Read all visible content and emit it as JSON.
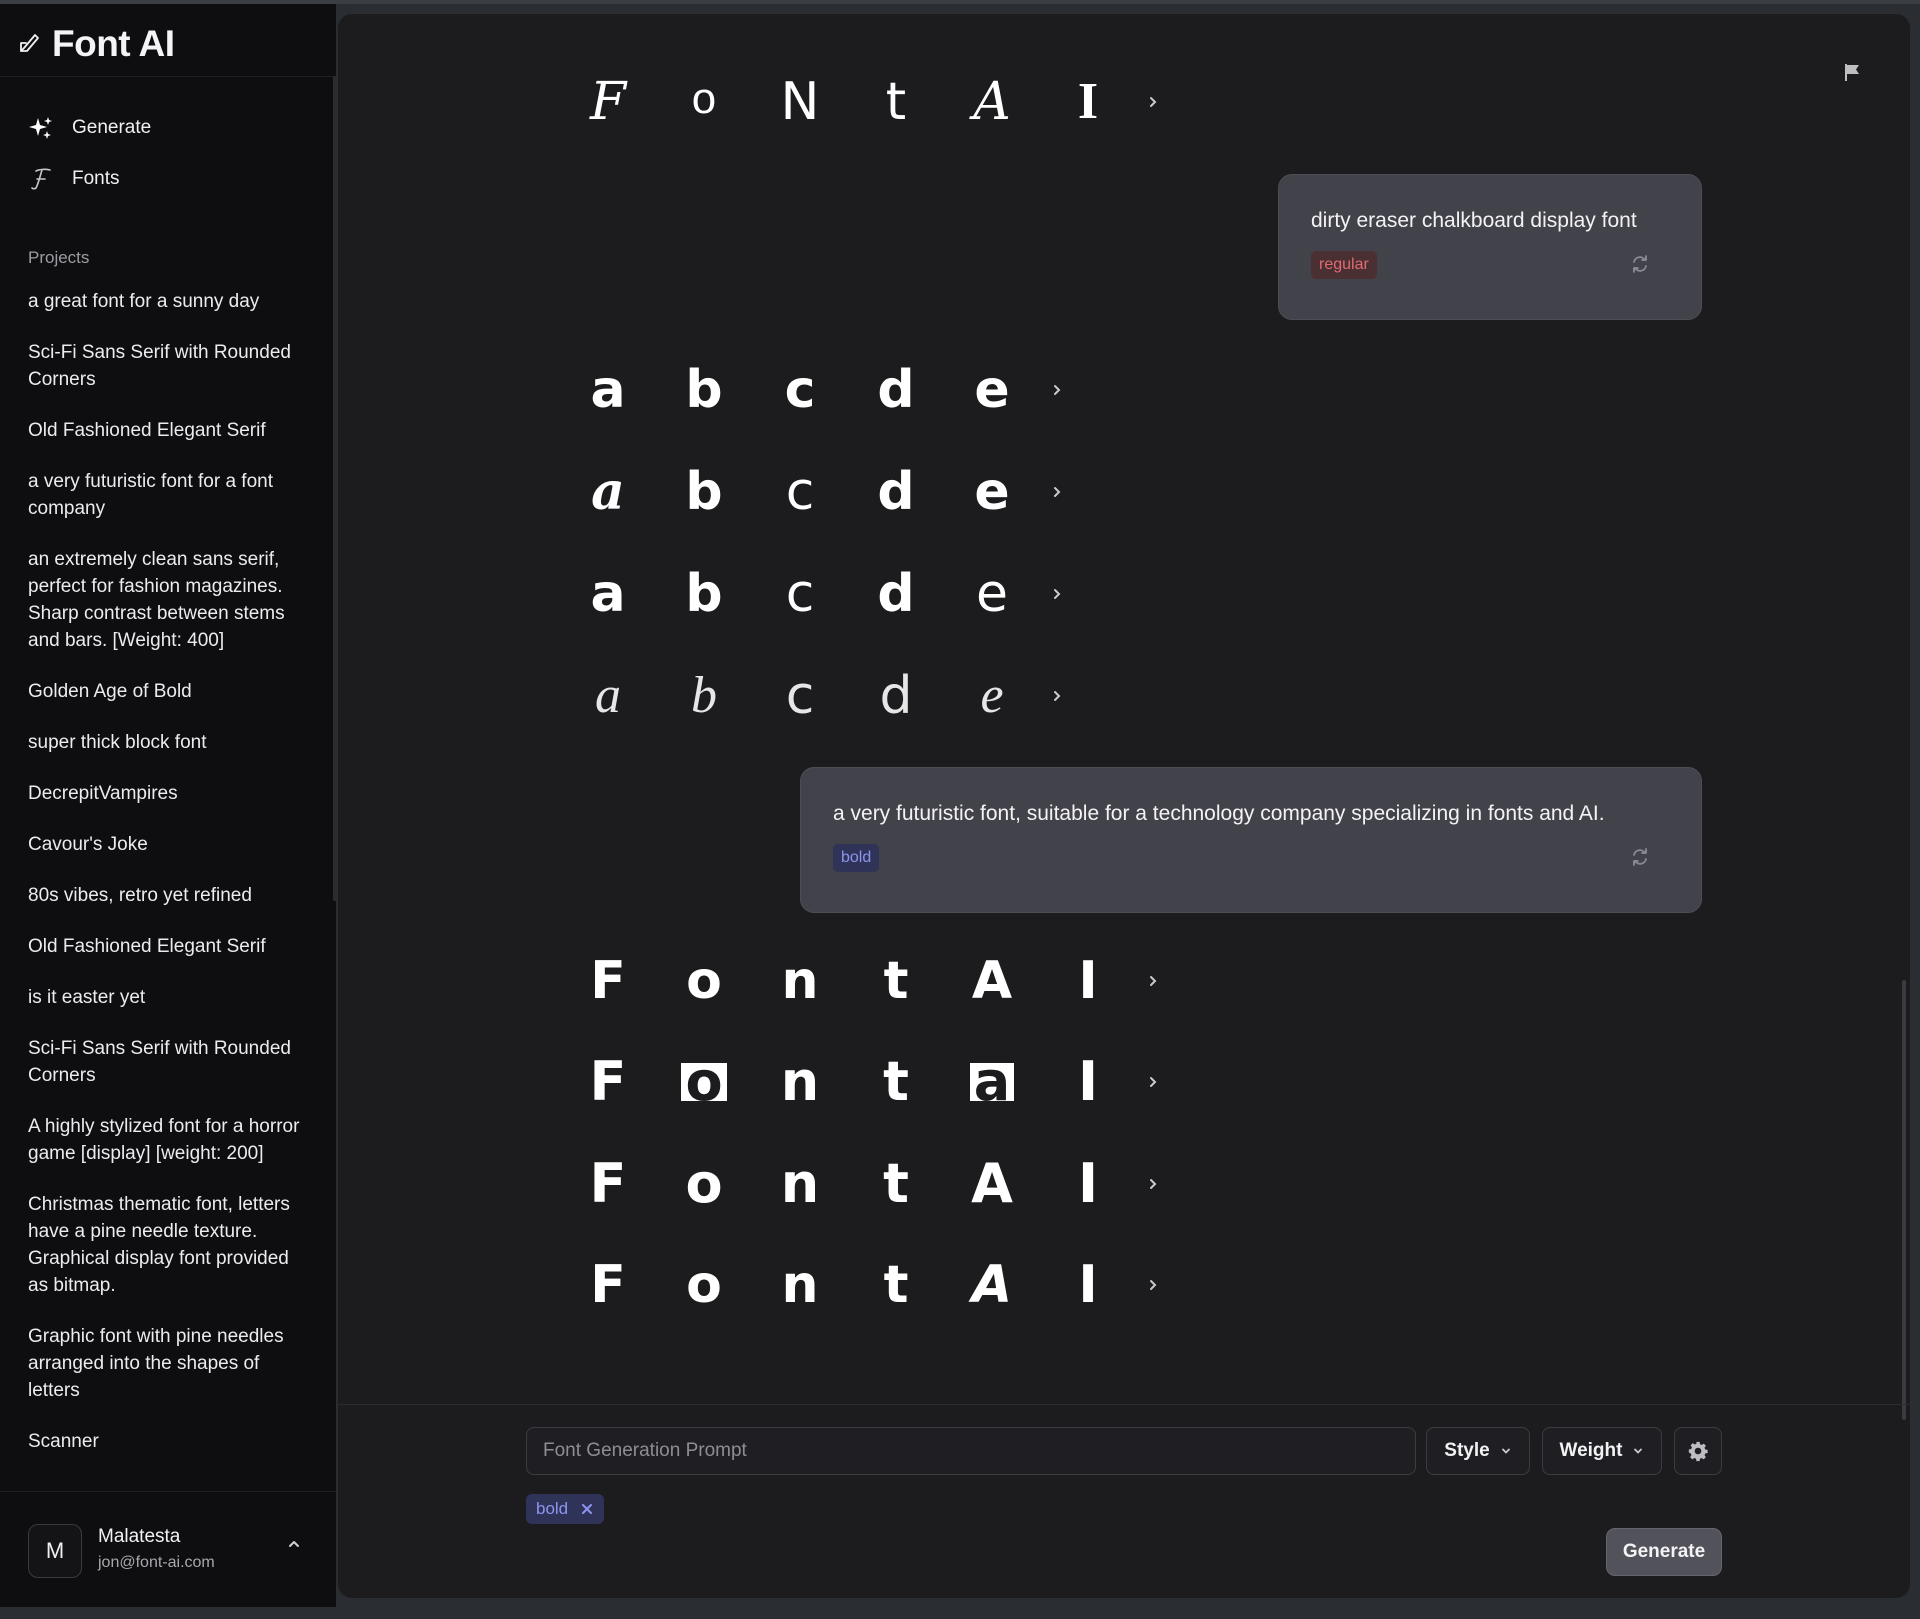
{
  "app": {
    "title": "Font AI"
  },
  "nav": [
    {
      "label": "Generate",
      "icon": "sparkles-icon"
    },
    {
      "label": "Fonts",
      "icon": "script-f-icon"
    }
  ],
  "projects": {
    "label": "Projects",
    "items": [
      "a great font for a sunny day",
      "Sci-Fi Sans Serif with Rounded Corners",
      "Old Fashioned Elegant Serif",
      "a very futuristic font for a font company",
      "an extremely clean sans serif, perfect for fashion magazines. Sharp contrast between stems and bars. [Weight: 400]",
      "Golden Age of Bold",
      "super thick block font",
      "DecrepitVampires",
      "Cavour's Joke",
      "80s vibes, retro yet refined",
      "Old Fashioned Elegant Serif",
      "is it easter yet",
      "Sci-Fi Sans Serif with Rounded Corners",
      "A highly stylized font for a horror game [display] [weight: 200]",
      "Christmas thematic font, letters have a pine needle texture. Graphical display font provided as bitmap.",
      "Graphic font with pine needles arranged into the shapes of letters",
      "Scanner"
    ]
  },
  "user": {
    "initial": "M",
    "name": "Malatesta",
    "email": "jon@font-ai.com"
  },
  "rows": {
    "r0": [
      "F",
      "o",
      "N",
      "t",
      "A",
      "I"
    ],
    "r1": [
      "a",
      "b",
      "c",
      "d",
      "e"
    ],
    "r2": [
      "a",
      "b",
      "c",
      "d",
      "e"
    ],
    "r3": [
      "a",
      "b",
      "c",
      "d",
      "e"
    ],
    "r4": [
      "a",
      "b",
      "c",
      "d",
      "e"
    ],
    "r5": [
      "F",
      "o",
      "n",
      "t",
      "A",
      "I"
    ],
    "r6": [
      "F",
      "o",
      "n",
      "t",
      "a",
      "I"
    ],
    "r7": [
      "F",
      "o",
      "n",
      "t",
      "A",
      "I"
    ],
    "r8": [
      "F",
      "o",
      "n",
      "t",
      "A",
      "I"
    ]
  },
  "prompts": [
    {
      "text": "dirty eraser chalkboard display font",
      "tag": "regular"
    },
    {
      "text": "a very futuristic font, suitable for a technology company specializing in fonts and AI.",
      "tag": "bold"
    }
  ],
  "composer": {
    "placeholder": "Font Generation Prompt",
    "style_label": "Style",
    "weight_label": "Weight",
    "chip_label": "bold",
    "generate_label": "Generate"
  },
  "colors": {
    "background": "#1c1c1f",
    "sidebar": "#0e0e10",
    "bubble": "#42424a",
    "regular_tag": "#e06b74",
    "bold_tag": "#8d95f0"
  }
}
